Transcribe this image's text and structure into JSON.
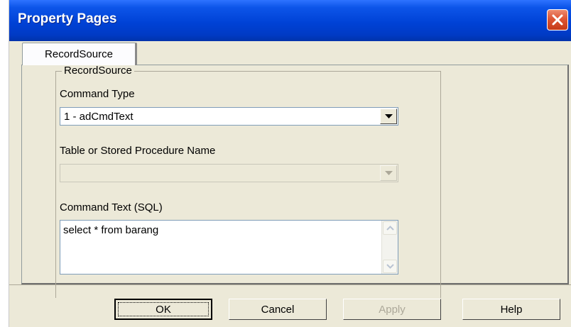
{
  "window": {
    "title": "Property Pages"
  },
  "tabs": [
    {
      "label": "RecordSource"
    }
  ],
  "group": {
    "legend": "RecordSource",
    "command_type": {
      "label": "Command Type",
      "value": "1 - adCmdText"
    },
    "table_name": {
      "label": "Table or Stored Procedure Name",
      "value": ""
    },
    "command_text": {
      "label": "Command Text (SQL)",
      "value": "select * from barang"
    }
  },
  "buttons": {
    "ok": "OK",
    "cancel": "Cancel",
    "apply": "Apply",
    "help": "Help"
  },
  "colors": {
    "titlebar": "#0042d6",
    "dialog_bg": "#ece9d8",
    "close_button": "#de5534",
    "disabled_text": "#aca899"
  },
  "icons": {
    "close": "close-icon",
    "dropdown": "chevron-down-icon",
    "scroll_up": "scroll-up-arrow-icon",
    "scroll_down": "scroll-down-arrow-icon"
  }
}
